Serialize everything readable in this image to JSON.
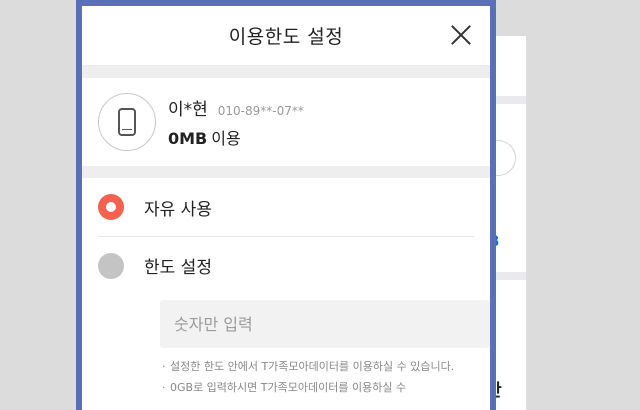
{
  "modal": {
    "title": "이용한도 설정"
  },
  "user": {
    "name": "이*현",
    "phone": "010-89**-07**",
    "usage_amount": "0MB",
    "usage_suffix": "이용"
  },
  "options": [
    {
      "label": "자유 사용",
      "selected": true
    },
    {
      "label": "한도 설정",
      "selected": false
    }
  ],
  "limit_input": {
    "placeholder": "숫자만 입력",
    "value": ""
  },
  "notes": [
    "설정한 한도 안에서 T가족모아데이터를 이용하실 수 있습니다.",
    "0GB로 입력하시면 T가족모아데이터를 이용하실 수"
  ],
  "background": {
    "blue_fragment": "B",
    "dark_fragment": "만"
  },
  "colors": {
    "modal_border": "#5a6fb7",
    "radio_selected": "#f2624f",
    "radio_unselected": "#c4c4c4"
  }
}
